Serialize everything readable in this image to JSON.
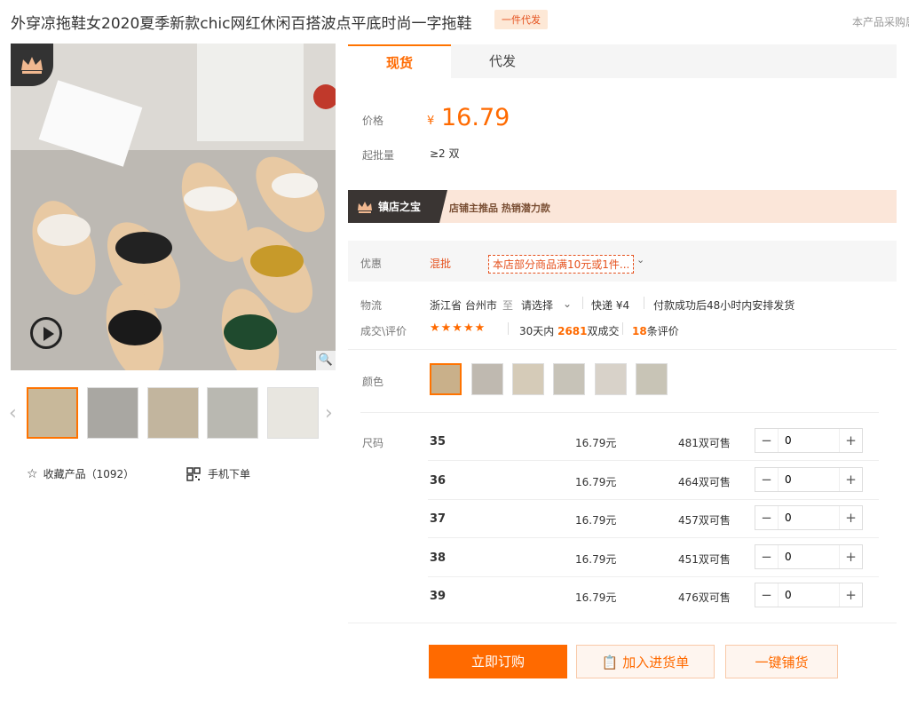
{
  "header": {
    "title": "外穿凉拖鞋女2020夏季新款chic网红休闲百搭波点平底时尚一字拖鞋",
    "badge": "一件代发",
    "note": "本产品采购属"
  },
  "gallery": {
    "fav_label": "收藏产品（1092）",
    "mobile_label": "手机下单"
  },
  "tabs": {
    "active": "现货",
    "other": "代发"
  },
  "price": {
    "label": "价格",
    "symbol": "¥",
    "value": "16.79",
    "moq_label": "起批量",
    "moq": "≥2 双"
  },
  "banner": {
    "title": "镇店之宝",
    "text": "店铺主推品  热销潜力款"
  },
  "promo": {
    "label": "优惠",
    "type": "混批",
    "tag": "本店部分商品满10元或1件...",
    "caret": "⌄"
  },
  "logistics": {
    "label": "物流",
    "origin": "浙江省 台州市",
    "to": "至",
    "dest": "请选择",
    "express": "快递 ¥4",
    "ship": "付款成功后48小时内安排发货"
  },
  "deals": {
    "label": "成交\\评价",
    "stars": "★★★★★",
    "period": "30天内",
    "count": "2681",
    "unit": "双成交",
    "reviews": "18",
    "reviews_unit": "条评价"
  },
  "color": {
    "label": "颜色"
  },
  "size": {
    "label": "尺码",
    "rows": [
      {
        "name": "35",
        "price": "16.79元",
        "stock": "481双可售",
        "qty": "0"
      },
      {
        "name": "36",
        "price": "16.79元",
        "stock": "464双可售",
        "qty": "0"
      },
      {
        "name": "37",
        "price": "16.79元",
        "stock": "457双可售",
        "qty": "0"
      },
      {
        "name": "38",
        "price": "16.79元",
        "stock": "451双可售",
        "qty": "0"
      },
      {
        "name": "39",
        "price": "16.79元",
        "stock": "476双可售",
        "qty": "0"
      }
    ]
  },
  "actions": {
    "order": "立即订购",
    "cart": "加入进货单",
    "dist": "一键铺货"
  }
}
